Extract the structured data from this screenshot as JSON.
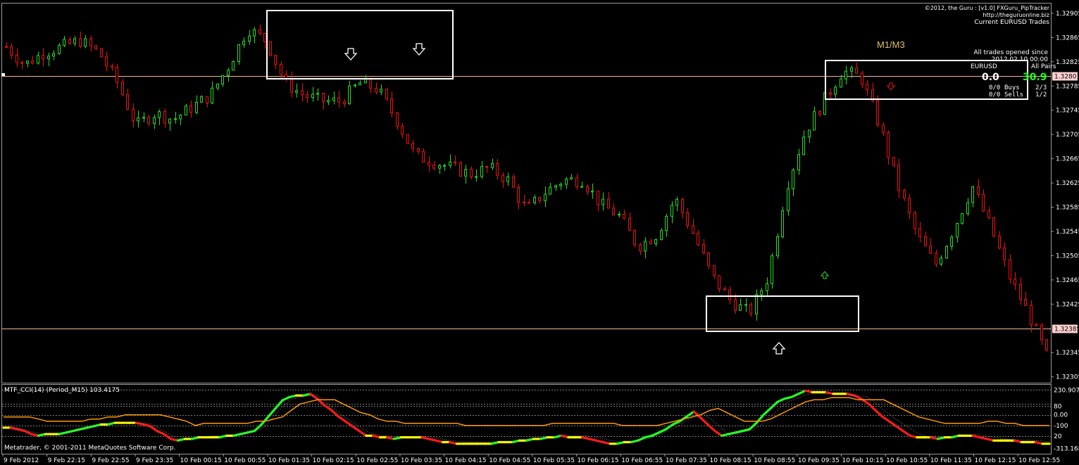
{
  "header": {
    "line1": "©2012, the Guru : [v1.0] FXGuru_PipTracker",
    "line2": "http://theguruonline.biz",
    "line3": "Current EURUSD Trades"
  },
  "tracker": {
    "line1": "All trades opened since",
    "line2": "2012.02.10 00:00",
    "col_left": "EURUSD",
    "col_right": "All Pairs",
    "pips_left": "0.0",
    "pips_right": "30.9",
    "buys_left": "0/0",
    "buys_label": "Buys",
    "buys_right": "2/3",
    "sells_left": "0/0",
    "sells_label": "Sells",
    "sells_right": "1/2"
  },
  "annotation": {
    "label": "M1/M3"
  },
  "indicator": {
    "title": "MTF_CCI(14) (Period_M15) 103.4175",
    "copyright": "Metatrader, © 2001-2011 MetaQuotes Software Corp.",
    "axis_labels": [
      "230.907",
      "80",
      "0.00",
      "-100",
      "20",
      "-313.168"
    ]
  },
  "colors": {
    "bull": "#22dd22",
    "bear": "#ee1111",
    "hline": "#f0b59a",
    "cci_orange": "#ff9900",
    "cci_green": "#22ff22",
    "cci_yellow": "#ffff00",
    "cci_red": "#ff1a1a",
    "annotation": "#e0c060",
    "pips_right": "#22ff22"
  },
  "chart_data": {
    "type": "candlestick",
    "symbol": "EURUSD",
    "price_axis": [
      "1.32905",
      "1.32865",
      "1.32825",
      "1.32785",
      "1.32745",
      "1.32705",
      "1.32665",
      "1.32625",
      "1.32585",
      "1.32545",
      "1.32505",
      "1.32465",
      "1.32425",
      "1.32345",
      "1.32305"
    ],
    "price_range": [
      1.323,
      1.3292
    ],
    "hlines": [
      {
        "value": 1.32801,
        "label": "1.32801"
      },
      {
        "value": 1.32385,
        "label": "1.32385"
      }
    ],
    "time_axis": [
      "9 Feb 2012",
      "9 Feb 22:15",
      "9 Feb 22:55",
      "9 Feb 23:35",
      "10 Feb 00:15",
      "10 Feb 00:55",
      "10 Feb 01:35",
      "10 Feb 02:15",
      "10 Feb 02:55",
      "10 Feb 03:35",
      "10 Feb 04:15",
      "10 Feb 04:55",
      "10 Feb 05:35",
      "10 Feb 06:15",
      "10 Feb 06:55",
      "10 Feb 07:35",
      "10 Feb 08:15",
      "10 Feb 08:55",
      "10 Feb 09:35",
      "10 Feb 10:15",
      "10 Feb 10:55",
      "10 Feb 11:35",
      "10 Feb 12:15",
      "10 Feb 12:55"
    ],
    "close_path": [
      1.3285,
      1.3282,
      1.3284,
      1.3285,
      1.3286,
      1.3284,
      1.3279,
      1.3272,
      1.3274,
      1.3273,
      1.3275,
      1.3277,
      1.3282,
      1.3288,
      1.3286,
      1.3279,
      1.3277,
      1.3276,
      1.3276,
      1.3279,
      1.3278,
      1.3273,
      1.3267,
      1.3266,
      1.3265,
      1.3264,
      1.3265,
      1.3263,
      1.3258,
      1.3261,
      1.3263,
      1.3263,
      1.3259,
      1.3257,
      1.3252,
      1.3254,
      1.326,
      1.3254,
      1.3247,
      1.3243,
      1.3241,
      1.3247,
      1.3262,
      1.3271,
      1.3276,
      1.3281,
      1.328,
      1.3272,
      1.3262,
      1.3254,
      1.3249,
      1.3255,
      1.3262,
      1.3255,
      1.3247,
      1.3241,
      1.3234
    ],
    "range": [
      1.323,
      1.3292
    ],
    "candle_count": 198
  },
  "cci": {
    "range": [
      -350,
      260
    ],
    "levels": [
      230.907,
      100,
      80,
      0,
      -100,
      -200
    ],
    "path": [
      -120,
      -190,
      -170,
      -110,
      -70,
      -90,
      -240,
      -210,
      -200,
      -150,
      150,
      200,
      -20,
      -190,
      -220,
      -210,
      -260,
      -270,
      -260,
      -230,
      -200,
      -210,
      -270,
      -240,
      -130,
      30,
      -200,
      -140,
      110,
      220,
      200,
      180,
      -40,
      -210,
      -220,
      -190,
      -240,
      -250,
      -270
    ]
  }
}
